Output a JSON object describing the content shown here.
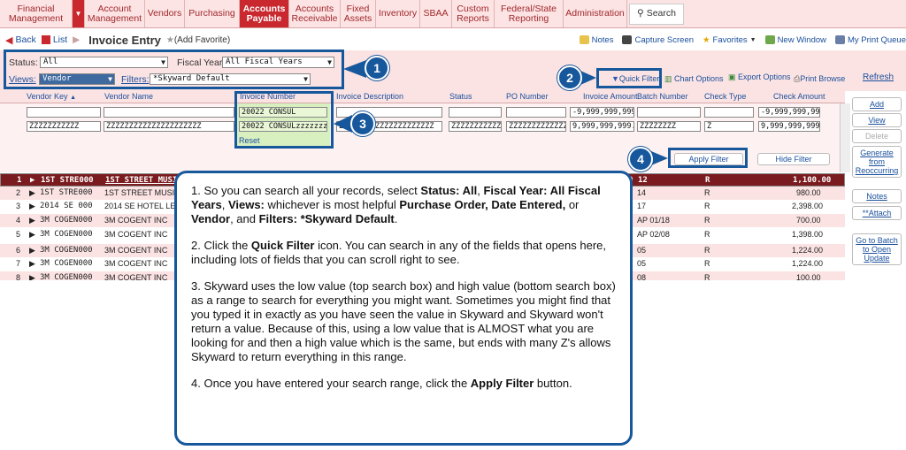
{
  "nav": {
    "items": [
      {
        "label": "Financial\nManagement"
      },
      {
        "label": "Account\nManagement"
      },
      {
        "label": "Vendors"
      },
      {
        "label": "Purchasing"
      },
      {
        "label": "Accounts\nPayable"
      },
      {
        "label": "Accounts\nReceivable"
      },
      {
        "label": "Fixed\nAssets"
      },
      {
        "label": "Inventory"
      },
      {
        "label": "SBAA"
      },
      {
        "label": "Custom\nReports"
      },
      {
        "label": "Federal/State\nReporting"
      },
      {
        "label": "Administration"
      }
    ],
    "search_label": "Search"
  },
  "breadcrumb": {
    "back": "Back",
    "list": "List",
    "title": "Invoice Entry",
    "add_favorite": "(Add Favorite)"
  },
  "toolbar": {
    "notes": "Notes",
    "capture": "Capture Screen",
    "favorites": "Favorites",
    "new_window": "New Window",
    "print_queue": "My Print Queue"
  },
  "filters": {
    "status_label": "Status:",
    "status_value": "All",
    "fiscal_year_label": "Fiscal Year:",
    "fiscal_year_value": "All Fiscal Years",
    "views_label": "Views:",
    "views_value": "Vendor",
    "filters_label": "Filters:",
    "filters_value": "*Skyward Default",
    "quick_filter": "Quick Filter",
    "chart_options": "Chart Options",
    "export_options": "Export Options",
    "print_browse": "Print Browse",
    "refresh": "Refresh"
  },
  "columns": [
    "Vendor Key",
    "Vendor Name",
    "Invoice Number",
    "Invoice Description",
    "Status",
    "PO Number",
    "Invoice Amount",
    "Batch Number",
    "Check Type",
    "Check Amount"
  ],
  "filter_low": {
    "vendor_key": "",
    "vendor_name": "",
    "invoice_number": "20022 CONSUL",
    "invoice_description": "",
    "status": "",
    "po_number": "",
    "invoice_amount": "-9,999,999,999.9",
    "batch_number": "",
    "check_type": "",
    "check_amount": "-9,999,999,999.9"
  },
  "filter_high": {
    "vendor_key": "ZZZZZZZZZZZ",
    "vendor_name": "ZZZZZZZZZZZZZZZZZZZZZ",
    "invoice_number": "20022 CONSULzzzzzzzz",
    "invoice_description": "ZZZZZZZZZZZZZZZZZZZZZ",
    "status": "ZZZZZZZZZZZ",
    "po_number": "ZZZZZZZZZZZZZZZZ",
    "invoice_amount": "9,999,999,999.9",
    "batch_number": "ZZZZZZZZ",
    "check_type": "Z",
    "check_amount": "9,999,999,999.9"
  },
  "reset": "Reset",
  "apply_filter": "Apply Filter",
  "hide_filter": "Hide Filter",
  "rows": [
    {
      "num": "1",
      "key": "1ST STRE000",
      "name": "1ST STREET MUSIC",
      "batch": "12",
      "ctype": "R",
      "amount": "1,100.00",
      "amtcol": "0"
    },
    {
      "num": "2",
      "key": "1ST STRE000",
      "name": "1ST STREET MUSIC",
      "batch": "14",
      "ctype": "R",
      "amount": "980.00",
      "amtcol": ""
    },
    {
      "num": "3",
      "key": "2014 SE 000",
      "name": "2014 SE HOTEL LES",
      "batch": "17",
      "ctype": "R",
      "amount": "2,398.00",
      "amtcol": ""
    },
    {
      "num": "4",
      "key": "3M COGEN000",
      "name": "3M COGENT INC",
      "batch": "AP 01/18",
      "ctype": "R",
      "amount": "700.00",
      "amtcol": ""
    },
    {
      "num": "5",
      "key": "3M COGEN000",
      "name": "3M COGENT INC",
      "batch": "AP 02/08",
      "ctype": "R",
      "amount": "1,398.00",
      "amtcol": ""
    },
    {
      "num": "6",
      "key": "3M COGEN000",
      "name": "3M COGENT INC",
      "batch": "05",
      "ctype": "R",
      "amount": "1,224.00",
      "amtcol": ""
    },
    {
      "num": "7",
      "key": "3M COGEN000",
      "name": "3M COGENT INC",
      "batch": "05",
      "ctype": "R",
      "amount": "1,224.00",
      "amtcol": ""
    },
    {
      "num": "8",
      "key": "3M COGEN000",
      "name": "3M COGENT INC",
      "batch": "08",
      "ctype": "R",
      "amount": "100.00",
      "amtcol": ""
    }
  ],
  "side_buttons": {
    "add": "Add",
    "view": "View",
    "delete": "Delete",
    "generate": "Generate\nfrom\nReoccurring",
    "notes": "Notes",
    "attach": "**Attach",
    "goto_batch": "Go to Batch\nto Open\nUpdate"
  },
  "callouts": {
    "one": "1",
    "two": "2",
    "three": "3",
    "four": "4"
  },
  "info": {
    "p1_a": "1. So you can search all your records, select ",
    "p1_b1": "Status: All",
    "p1_c": ", ",
    "p1_b2": "Fiscal Year: All Fiscal Years",
    "p1_d": ", ",
    "p1_b3": "Views:",
    "p1_e": " whichever is most helpful ",
    "p1_b4": "Purchase Order, Date Entered,",
    "p1_f": " or ",
    "p1_b5": "Vendor",
    "p1_g": ", and ",
    "p1_b6": "Filters: *Skyward Default",
    "p1_h": ".",
    "p2_a": "2. Click the ",
    "p2_b": "Quick Filter",
    "p2_c": " icon. You can search in any of the fields that opens here, including lots of fields that you can scroll right to see.",
    "p3": "3. Skyward uses the low value (top search box) and high value (bottom search box) as a range to search for everything you might want. Sometimes you might find that you typed it in exactly as you have seen the value in Skyward and Skyward won't return a value. Because of this, using a low value that is ALMOST what you are looking for and then a high value which is the same, but ends with many Z's allows Skyward to return everything in this range.",
    "p4_a": "4. Once you have entered your search range, click the ",
    "p4_b": "Apply Filter",
    "p4_c": " button."
  }
}
